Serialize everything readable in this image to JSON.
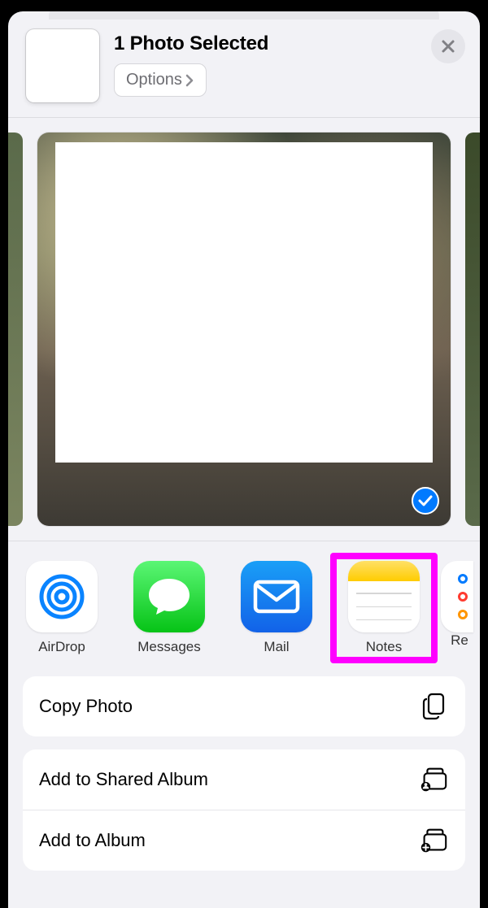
{
  "header": {
    "title": "1 Photo Selected",
    "options_label": "Options"
  },
  "photo": {
    "selected": true
  },
  "apps": [
    {
      "id": "airdrop",
      "label": "AirDrop",
      "highlighted": false
    },
    {
      "id": "messages",
      "label": "Messages",
      "highlighted": false
    },
    {
      "id": "mail",
      "label": "Mail",
      "highlighted": false
    },
    {
      "id": "notes",
      "label": "Notes",
      "highlighted": true
    },
    {
      "id": "reminders",
      "label": "Re",
      "highlighted": false,
      "partial": true
    }
  ],
  "actions_group_1": [
    {
      "id": "copy-photo",
      "label": "Copy Photo",
      "icon": "copy"
    }
  ],
  "actions_group_2": [
    {
      "id": "add-shared-album",
      "label": "Add to Shared Album",
      "icon": "shared-album"
    },
    {
      "id": "add-album",
      "label": "Add to Album",
      "icon": "add-album"
    }
  ],
  "highlight_color": "#ff00ff"
}
